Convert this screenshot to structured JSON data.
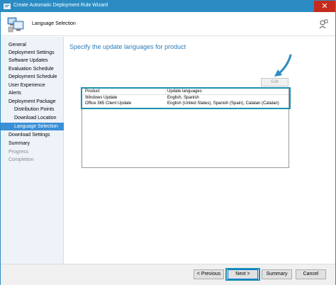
{
  "window": {
    "title": "Create Automatic Deployment Rule Wizard",
    "close_glyph": "✕"
  },
  "header": {
    "page_heading": "Language Selection"
  },
  "sidebar": {
    "items": [
      {
        "label": "General",
        "state": "normal"
      },
      {
        "label": "Deployment Settings",
        "state": "normal"
      },
      {
        "label": "Software Updates",
        "state": "normal"
      },
      {
        "label": "Evaluation Schedule",
        "state": "normal"
      },
      {
        "label": "Deployment Schedule",
        "state": "normal"
      },
      {
        "label": "User Experience",
        "state": "normal"
      },
      {
        "label": "Alerts",
        "state": "normal"
      },
      {
        "label": "Deployment Package",
        "state": "normal"
      },
      {
        "label": "Distribution Points",
        "state": "normal"
      },
      {
        "label": "Download Location",
        "state": "normal"
      },
      {
        "label": "Language Selection",
        "state": "active"
      },
      {
        "label": "Download Settings",
        "state": "normal"
      },
      {
        "label": "Summary",
        "state": "normal"
      },
      {
        "label": "Progress",
        "state": "disabled"
      },
      {
        "label": "Completion",
        "state": "disabled"
      }
    ]
  },
  "main": {
    "section_title": "Specify the update languages for product",
    "edit_label": "Edit",
    "table": {
      "columns": [
        "Product",
        "Update languages"
      ],
      "rows": [
        [
          "Windows Update",
          "English, Spanish"
        ],
        [
          "Office 365 Client Update",
          "English (United States), Spanish (Spain), Catalan (Catalan)"
        ]
      ]
    }
  },
  "footer": {
    "previous_label": "< Previous",
    "next_label": "Next >",
    "summary_label": "Summary",
    "cancel_label": "Cancel"
  },
  "colors": {
    "title_bar": "#2b8cc4",
    "accent": "#3a8fd6",
    "highlight": "#1e8fb0",
    "close": "#c42b1c"
  }
}
